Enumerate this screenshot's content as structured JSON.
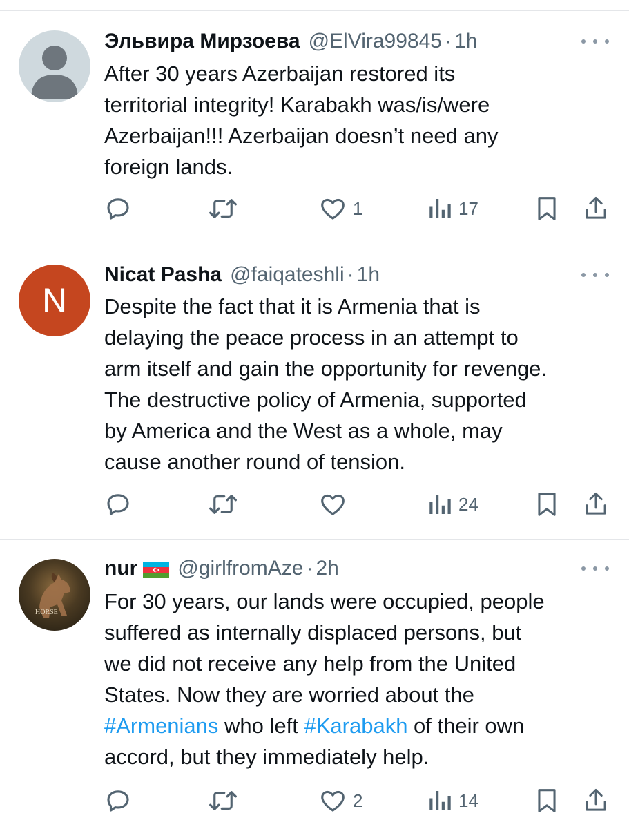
{
  "tweets": [
    {
      "name": "Эльвира Мирзоева",
      "handle": "@ElVira99845",
      "separator": "·",
      "time": "1h",
      "avatar": "default-avatar",
      "lines": [
        [
          {
            "text": "After 30 years Azerbaijan restored its"
          }
        ],
        [
          {
            "text": "territorial integrity! Karabakh was/is/were"
          }
        ],
        [
          {
            "text": "Azerbaijan!!! Azerbaijan doesn’t need any"
          }
        ],
        [
          {
            "text": "foreign lands."
          }
        ]
      ],
      "actions": {
        "replies": "",
        "reposts": "",
        "likes": "1",
        "views": "17"
      }
    },
    {
      "name": "Nicat Pasha",
      "handle": "@faiqateshli",
      "separator": "·",
      "time": "1h",
      "avatar": "letter-avatar",
      "avatar_letter": "N",
      "lines": [
        [
          {
            "text": "Despite the fact that it is Armenia that is"
          }
        ],
        [
          {
            "text": "delaying the peace process in an attempt to"
          }
        ],
        [
          {
            "text": "arm itself and gain the opportunity for revenge."
          }
        ],
        [
          {
            "text": "The destructive policy of Armenia, supported"
          }
        ],
        [
          {
            "text": "by America and the West as a whole, may"
          }
        ],
        [
          {
            "text": "cause another round of tension."
          }
        ]
      ],
      "actions": {
        "replies": "",
        "reposts": "",
        "likes": "",
        "views": "24"
      }
    },
    {
      "name": "nur",
      "flag": "azerbaijan-flag",
      "handle": "@girlfromAze",
      "separator": "·",
      "time": "2h",
      "avatar": "horse-photo-avatar",
      "avatar_text": "HORSE",
      "lines": [
        [
          {
            "text": "For 30 years, our lands were occupied, people"
          }
        ],
        [
          {
            "text": "suffered as internally displaced persons, but"
          }
        ],
        [
          {
            "text": "we did not receive any help from the United"
          }
        ],
        [
          {
            "text": "States. Now they are worried about the"
          }
        ],
        [
          {
            "text": "#Armenians",
            "hashtag": true
          },
          {
            "text": " who left "
          },
          {
            "text": "#Karabakh",
            "hashtag": true
          },
          {
            "text": " of their own"
          }
        ],
        [
          {
            "text": "accord, but they immediately help."
          }
        ]
      ],
      "actions": {
        "replies": "",
        "reposts": "",
        "likes": "2",
        "views": "14"
      }
    }
  ],
  "icons": {
    "reply": "reply-icon",
    "repost": "repost-icon",
    "like": "heart-icon",
    "views": "views-icon",
    "bookmark": "bookmark-icon",
    "share": "share-icon",
    "more": "more-icon"
  },
  "colors": {
    "text": "#0f1419",
    "secondary": "#536471",
    "hashtag": "#1d9bf0",
    "divider": "#e4e6e9",
    "letter_avatar": "#c5461f"
  }
}
